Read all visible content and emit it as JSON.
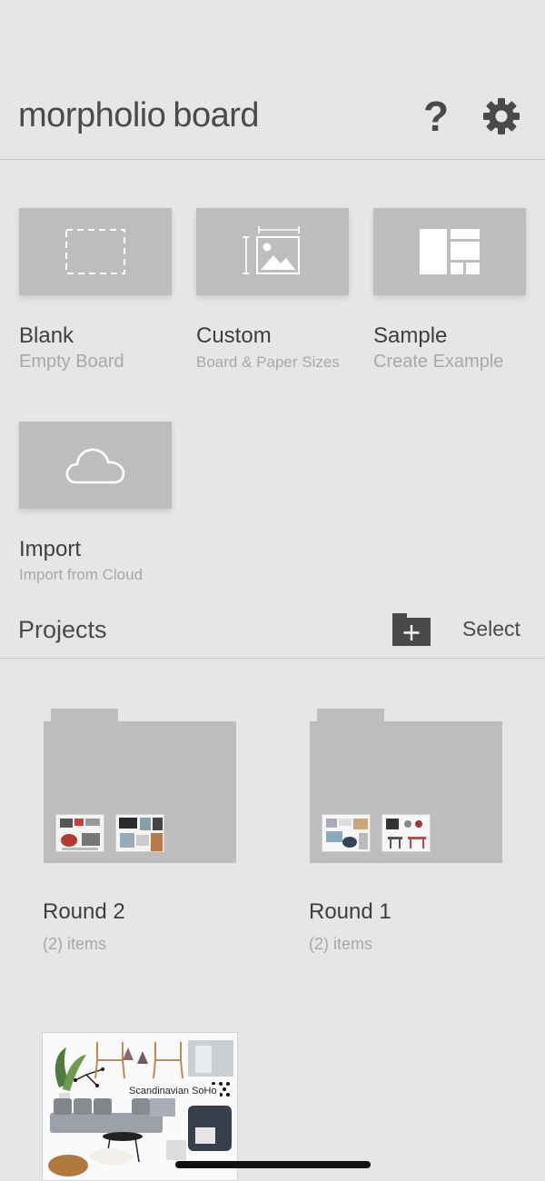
{
  "header": {
    "title_part1": "morpholio",
    "title_part2": "board",
    "help_icon": "help-icon",
    "settings_icon": "gear-icon"
  },
  "new_board_options": [
    {
      "title": "Blank",
      "subtitle": "Empty Board",
      "icon": "dashed-rectangle-icon"
    },
    {
      "title": "Custom",
      "subtitle": "Board & Paper Sizes",
      "icon": "custom-size-image-icon"
    },
    {
      "title": "Sample",
      "subtitle": "Create Example",
      "icon": "sample-layout-icon"
    },
    {
      "title": "Import",
      "subtitle": "Import from Cloud",
      "icon": "cloud-icon"
    }
  ],
  "projects": {
    "title": "Projects",
    "new_folder_icon": "new-folder-icon",
    "select_label": "Select",
    "folders": [
      {
        "name": "Round 2",
        "count": "(2) items"
      },
      {
        "name": "Round 1",
        "count": "(2) items"
      }
    ],
    "boards": [
      {
        "label": "Scandinavian SoHo"
      }
    ]
  },
  "colors": {
    "background": "#e6e6e6",
    "tile": "#bdbdbd",
    "text_primary": "#3e3e3e",
    "text_secondary": "#a8a8a8",
    "icon_dark": "#4a4a4a"
  }
}
